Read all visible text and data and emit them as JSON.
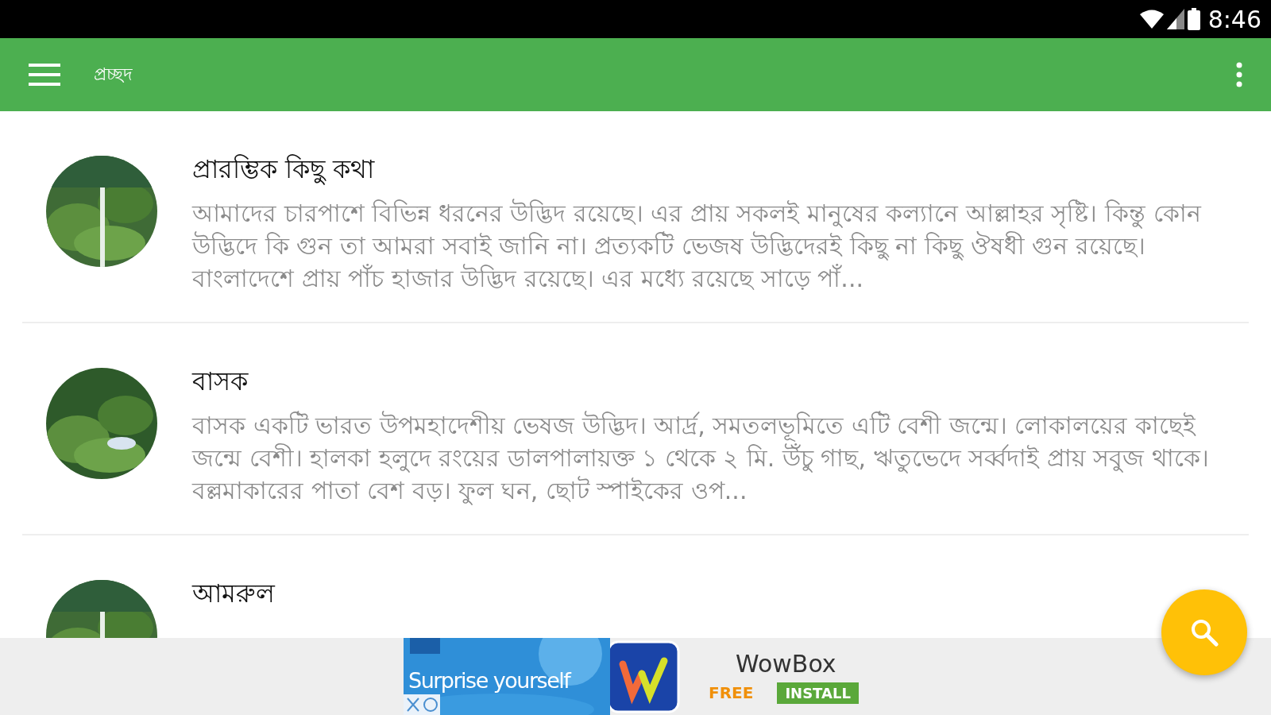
{
  "status_bar": {
    "time": "8:46"
  },
  "app_bar": {
    "title": "প্রচ্ছদ"
  },
  "items": [
    {
      "title": "প্রারম্ভিক কিছু কথা",
      "description": "আমাদের চারপাশে বিভিন্ন ধরনের উদ্ভিদ রয়েছে। এর প্রায় সকলই মানুষের কল্যানে আল্লাহর সৃষ্টি। কিন্তু কোন উদ্ভিদে কি গুন তা আমরা সবাই জানি না। প্রত্যকটি ভেজষ উদ্ভিদেরই কিছু না কিছু ঔষধী গুন রয়েছে। বাংলাদেশে প্রায় পাঁচ হাজার উদ্ভিদ রয়েছে। এর মধ্যে রয়েছে সাড়ে পাঁ..."
    },
    {
      "title": "বাসক",
      "description": "বাসক একটি ভারত উপমহাদেশীয় ভেষজ উদ্ভিদ। আর্দ্র, সমতলভূমিতে এটি বেশী জন্মে। লোকালয়ের কাছেই জন্মে বেশী। হালকা হলুদে রংয়ের ডালপালায়ক্ত ১ থেকে ২ মি. উঁচু গাছ, ঋতুভেদে সর্ব্বদাই প্রায় সবুজ থাকে। বল্লমাকারের পাতা বেশ বড়। ফুল ঘন, ছোট স্পাইকের ওপ..."
    },
    {
      "title": "আমরুল"
    }
  ],
  "ad": {
    "tagline": "Surprise yourself",
    "app_name": "WowBox",
    "price": "FREE",
    "button": "INSTALL"
  }
}
